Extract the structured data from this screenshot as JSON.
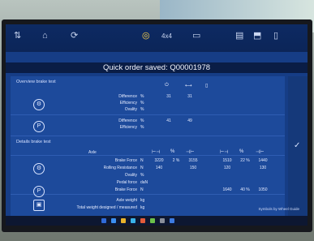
{
  "banner": {
    "message": "Quick order saved: Q00001978"
  },
  "topbar": {
    "mode_label": "4x4"
  },
  "overview": {
    "title": "Overview brake test",
    "rows": [
      {
        "label": "Difference",
        "unit": "%",
        "values": [
          "31",
          "31"
        ]
      },
      {
        "label": "Efficiency",
        "unit": "%",
        "values": [
          "",
          ""
        ]
      },
      {
        "label": "Ovality",
        "unit": "%",
        "values": [
          "",
          ""
        ]
      },
      {
        "label": "Difference",
        "unit": "%",
        "values": [
          "41",
          "49"
        ]
      },
      {
        "label": "Efficiency",
        "unit": "%",
        "values": [
          "",
          ""
        ]
      }
    ]
  },
  "details": {
    "title": "Details brake test",
    "col_axle": "Axle",
    "col_percent": "%",
    "rows": [
      {
        "label": "Brake Force",
        "unit": "N",
        "values": [
          "3220",
          "2 %",
          "3155",
          "1510",
          "22 %",
          "1440"
        ]
      },
      {
        "label": "Rolling Resistance",
        "unit": "N",
        "values": [
          "140",
          "",
          "150",
          "120",
          "",
          "130"
        ]
      },
      {
        "label": "Ovality",
        "unit": "%",
        "values": [
          "",
          "",
          "",
          "",
          "",
          ""
        ]
      },
      {
        "label": "Pedal force",
        "unit": "daN",
        "values": [
          "",
          "",
          "",
          "",
          "",
          ""
        ]
      },
      {
        "label": "Brake Force",
        "unit": "N",
        "values": [
          "",
          "",
          "",
          "1640",
          "40 %",
          "1050"
        ]
      },
      {
        "label": "Axle weight",
        "unit": "kg",
        "values": [
          "",
          "",
          "",
          "",
          "",
          ""
        ]
      },
      {
        "label": "Total weight designed / measured",
        "unit": "kg",
        "values": [
          "",
          "",
          "",
          "",
          "",
          ""
        ]
      }
    ]
  },
  "footer_note": "Symbols by Wheel Guide"
}
